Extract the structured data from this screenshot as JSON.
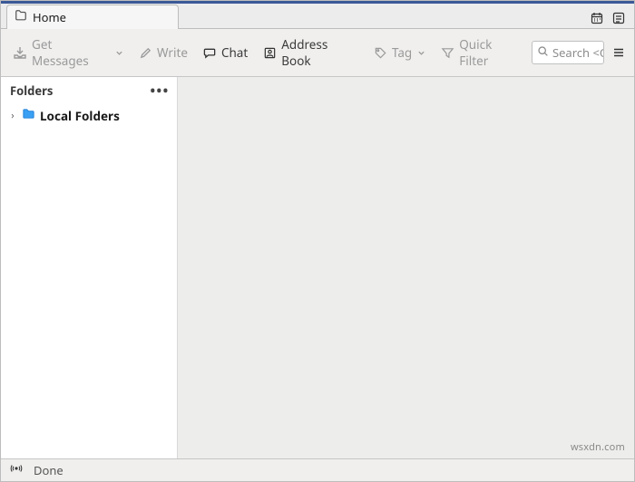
{
  "tabs": {
    "home_label": "Home"
  },
  "toolbar": {
    "get_messages_label": "Get Messages",
    "write_label": "Write",
    "chat_label": "Chat",
    "address_book_label": "Address Book",
    "tag_label": "Tag",
    "quick_filter_label": "Quick Filter",
    "search_placeholder": "Search <C"
  },
  "sidebar": {
    "heading": "Folders",
    "items": [
      {
        "label": "Local Folders"
      }
    ]
  },
  "status": {
    "text": "Done"
  },
  "watermark": "wsxdn.com"
}
